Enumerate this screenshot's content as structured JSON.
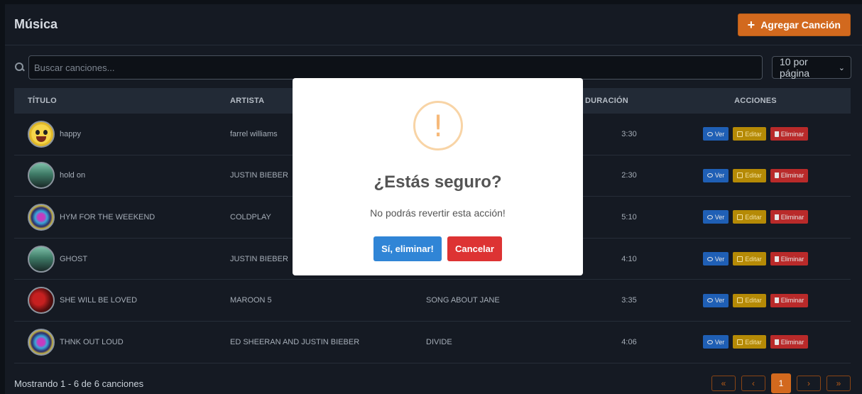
{
  "header": {
    "title": "Música",
    "add_button": "Agregar Canción"
  },
  "search": {
    "placeholder": "Buscar canciones...",
    "per_page": "10 por página"
  },
  "table": {
    "headers": {
      "title": "TÍTULO",
      "artist": "ARTISTA",
      "album": "",
      "duration": "DURACIÓN",
      "actions": "ACCIONES"
    },
    "rows": [
      {
        "title": "happy",
        "artist": "farrel williams",
        "album": "",
        "duration": "3:30",
        "avatar": "happy"
      },
      {
        "title": "hold on",
        "artist": "JUSTIN BIEBER",
        "album": "",
        "duration": "2:30",
        "avatar": "bieber"
      },
      {
        "title": "HYM FOR THE WEEKEND",
        "artist": "COLDPLAY",
        "album": "",
        "duration": "5:10",
        "avatar": "coldplay"
      },
      {
        "title": "GHOST",
        "artist": "JUSTIN BIEBER",
        "album": "",
        "duration": "4:10",
        "avatar": "bieber"
      },
      {
        "title": "SHE WILL BE LOVED",
        "artist": "MAROON 5",
        "album": "SONG ABOUT JANE",
        "duration": "3:35",
        "avatar": "maroon"
      },
      {
        "title": "THNK OUT LOUD",
        "artist": "ED SHEERAN AND JUSTIN BIEBER",
        "album": "DIVIDE",
        "duration": "4:06",
        "avatar": "coldplay"
      }
    ],
    "actions": {
      "view": "Ver",
      "edit": "Editar",
      "delete": "Eliminar"
    }
  },
  "footer": {
    "showing": "Mostrando 1 - 6 de 6 canciones",
    "current_page": "1"
  },
  "modal": {
    "icon": "!",
    "title": "¿Estás seguro?",
    "text": "No podrás revertir esta acción!",
    "confirm": "Sí, eliminar!",
    "cancel": "Cancelar"
  },
  "colors": {
    "accent": "#d2691e",
    "confirm": "#3085d6",
    "cancel": "#dd3333"
  }
}
